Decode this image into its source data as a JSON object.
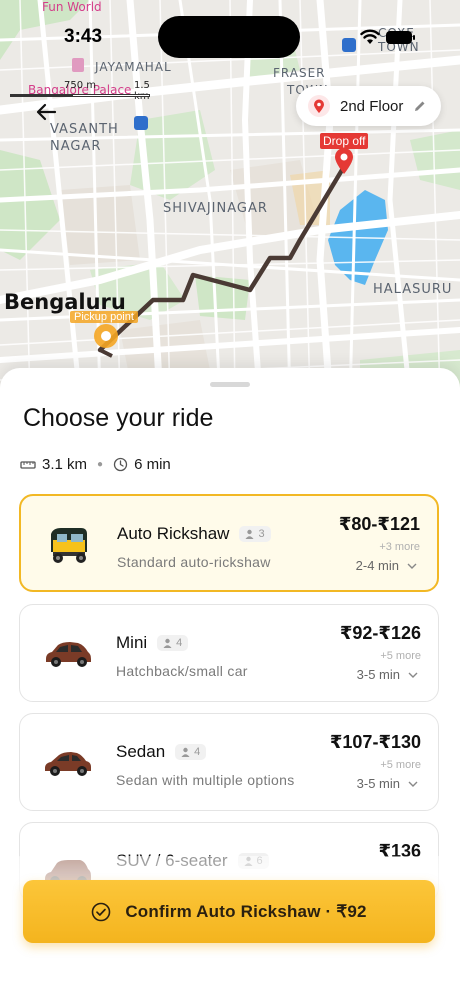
{
  "status_bar": {
    "time": "3:43"
  },
  "map": {
    "labels": {
      "fun_world": "Fun World",
      "jayamahal": "JAYAMAHAL",
      "bangalore_palace": "Bangalore Palace",
      "fraser_town": "FRASER",
      "fraser_town_2": "TOWN",
      "cox_town": "COXE TOWN",
      "vasanth_nagar_1": "VASANTH",
      "vasanth_nagar_2": "NAGAR",
      "shivajinagar": "SHIVAJINAGAR",
      "halasuru": "HALASURU",
      "city": "Bengaluru"
    },
    "scale": {
      "left": "750 m",
      "right": "1.5 km"
    },
    "drop_label": "Drop off",
    "pickup_label": "Pickup point",
    "floor_chip": "2nd Floor"
  },
  "sheet": {
    "title": "Choose your ride",
    "distance": "3.1 km",
    "duration": "6 min"
  },
  "rides": [
    {
      "name": "Auto Rickshaw",
      "seats": "3",
      "desc": "Standard auto-rickshaw",
      "price": "₹80-₹121",
      "more": "+3 more",
      "eta": "2-4 min",
      "selected": true
    },
    {
      "name": "Mini",
      "seats": "4",
      "desc": "Hatchback/small car",
      "price": "₹92-₹126",
      "more": "+5 more",
      "eta": "3-5 min",
      "selected": false
    },
    {
      "name": "Sedan",
      "seats": "4",
      "desc": "Sedan with multiple options",
      "price": "₹107-₹130",
      "more": "+5 more",
      "eta": "3-5 min",
      "selected": false
    },
    {
      "name": "SUV / 6-seater",
      "seats": "6",
      "desc": "",
      "price": "₹136",
      "more": "",
      "eta": "",
      "selected": false
    }
  ],
  "confirm": {
    "label": "Confirm Auto Rickshaw · ₹92"
  },
  "colors": {
    "accent": "#f4b41e",
    "route": "#4a3a34",
    "drop": "#e53935"
  }
}
